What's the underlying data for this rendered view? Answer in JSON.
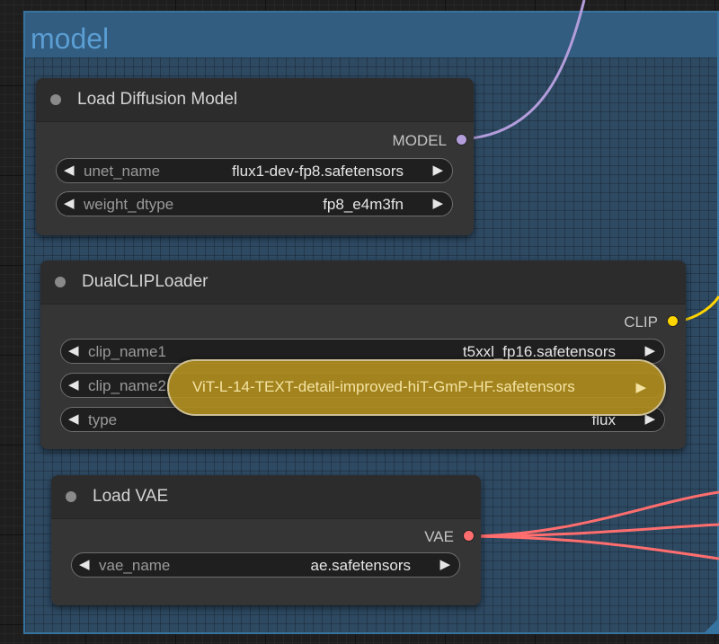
{
  "group": {
    "title": "model"
  },
  "nodes": {
    "load_diffusion_model": {
      "title": "Load Diffusion Model",
      "output": "MODEL",
      "widgets": [
        {
          "name": "unet_name",
          "value": "flux1-dev-fp8.safetensors"
        },
        {
          "name": "weight_dtype",
          "value": "fp8_e4m3fn"
        }
      ]
    },
    "dual_clip_loader": {
      "title": "DualCLIPLoader",
      "output": "CLIP",
      "widgets": [
        {
          "name": "clip_name1",
          "value": "t5xxl_fp16.safetensors"
        },
        {
          "name": "clip_name2",
          "value": "ViT-L-14-TEXT-detail-improved-hiT-GmP-HF.safetensors"
        },
        {
          "name": "type",
          "value": "flux"
        }
      ]
    },
    "load_vae": {
      "title": "Load VAE",
      "output": "VAE",
      "widgets": [
        {
          "name": "vae_name",
          "value": "ae.safetensors"
        }
      ]
    }
  },
  "colors": {
    "model_wire": "#b39ddb",
    "clip_wire": "#ffd500",
    "vae_wire": "#ff6e6e",
    "group_accent": "#5a9ed3"
  },
  "icons": {
    "left_arrow": "◀",
    "right_arrow": "▶"
  }
}
